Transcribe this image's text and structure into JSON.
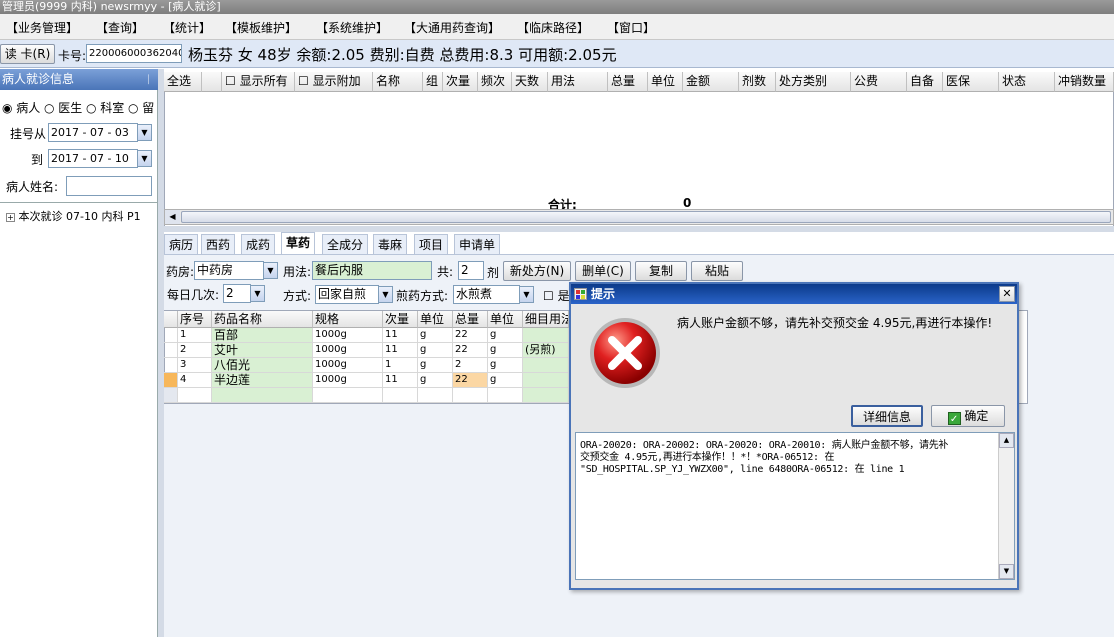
{
  "window": {
    "title": "管理员(9999 内科) newsrmyy - [病人就诊]"
  },
  "menu": [
    "【业务管理】",
    "【查询】",
    "【统计】",
    "【模板维护】",
    "【系统维护】",
    "【大通用药查询】",
    "【临床路径】",
    "【窗口】"
  ],
  "patient": {
    "read_card_label": "读 卡(R)",
    "card_label": "卡号:",
    "card_no": "220006000362040",
    "summary": "杨玉芬 女 48岁 余额:2.05 费别:自费 总费用:8.3 可用额:2.05元"
  },
  "left": {
    "header": "病人就诊信息",
    "pin": "ᛁ",
    "radios": [
      "病人",
      "医生",
      "科室",
      "留"
    ],
    "reg_from_label": "挂号从",
    "reg_from": "2017 - 07 - 03",
    "reg_to_label": "到",
    "reg_to": "2017 - 07 - 10",
    "name_label": "病人姓名:",
    "name_value": "",
    "tree_item": "本次就诊 07-10 内科 P1"
  },
  "top_grid": {
    "columns": [
      "全选",
      "",
      "显示所有",
      "显示附加",
      "名称",
      "组",
      "次量",
      "频次",
      "天数",
      "用法",
      "总量",
      "单位",
      "金额",
      "剂数",
      "处方类别",
      "公费",
      "自备",
      "医保",
      "状态",
      "冲销数量"
    ],
    "total_label": "合计:",
    "total_value": "0"
  },
  "tabs": [
    "病历",
    "西药",
    "成药",
    "草药",
    "全成分",
    "毒麻",
    "项目",
    "申请单"
  ],
  "active_tab": "草药",
  "form": {
    "pharmacy_label": "药房:",
    "pharmacy": "中药房",
    "usage_label": "用法:",
    "usage": "餐后内服",
    "count_label": "共:",
    "count": "2",
    "count_unit": "剂",
    "new_btn": "新处方(N)",
    "del_btn": "删单(C)",
    "copy_btn": "复制",
    "paste_btn": "粘贴",
    "daily_label": "每日几次:",
    "daily": "2",
    "method_label": "方式:",
    "method": "回家自煎",
    "decoct_label": "煎药方式:",
    "decoct": "水煎煮",
    "check_label": "是"
  },
  "herb_table": {
    "columns": [
      "序号",
      "药品名称",
      "规格",
      "次量",
      "单位",
      "总量",
      "单位",
      "细目用法"
    ],
    "rows": [
      [
        "1",
        "百部",
        "1000g",
        "11",
        "g",
        "22",
        "g",
        ""
      ],
      [
        "2",
        "艾叶",
        "1000g",
        "11",
        "g",
        "22",
        "g",
        "(另煎)"
      ],
      [
        "3",
        "八佰光",
        "1000g",
        "1",
        "g",
        "2",
        "g",
        ""
      ],
      [
        "4",
        "半边莲",
        "1000g",
        "11",
        "g",
        "22",
        "g",
        ""
      ]
    ]
  },
  "dialog": {
    "title": "提示",
    "close": "✕",
    "message": "病人账户金额不够，请先补交预交金 4.95元,再进行本操作!",
    "detail_btn": "详细信息",
    "ok_btn": "确定",
    "detail_lines": [
      "ORA-20020: ORA-20002: ORA-20020: ORA-20010: 病人账户金额不够，请先补",
      "交预交金 4.95元,再进行本操作！！*！*ORA-06512: 在",
      "\"SD_HOSPITAL.SP_YJ_YWZX00\", line 6480ORA-06512: 在 line 1"
    ]
  }
}
